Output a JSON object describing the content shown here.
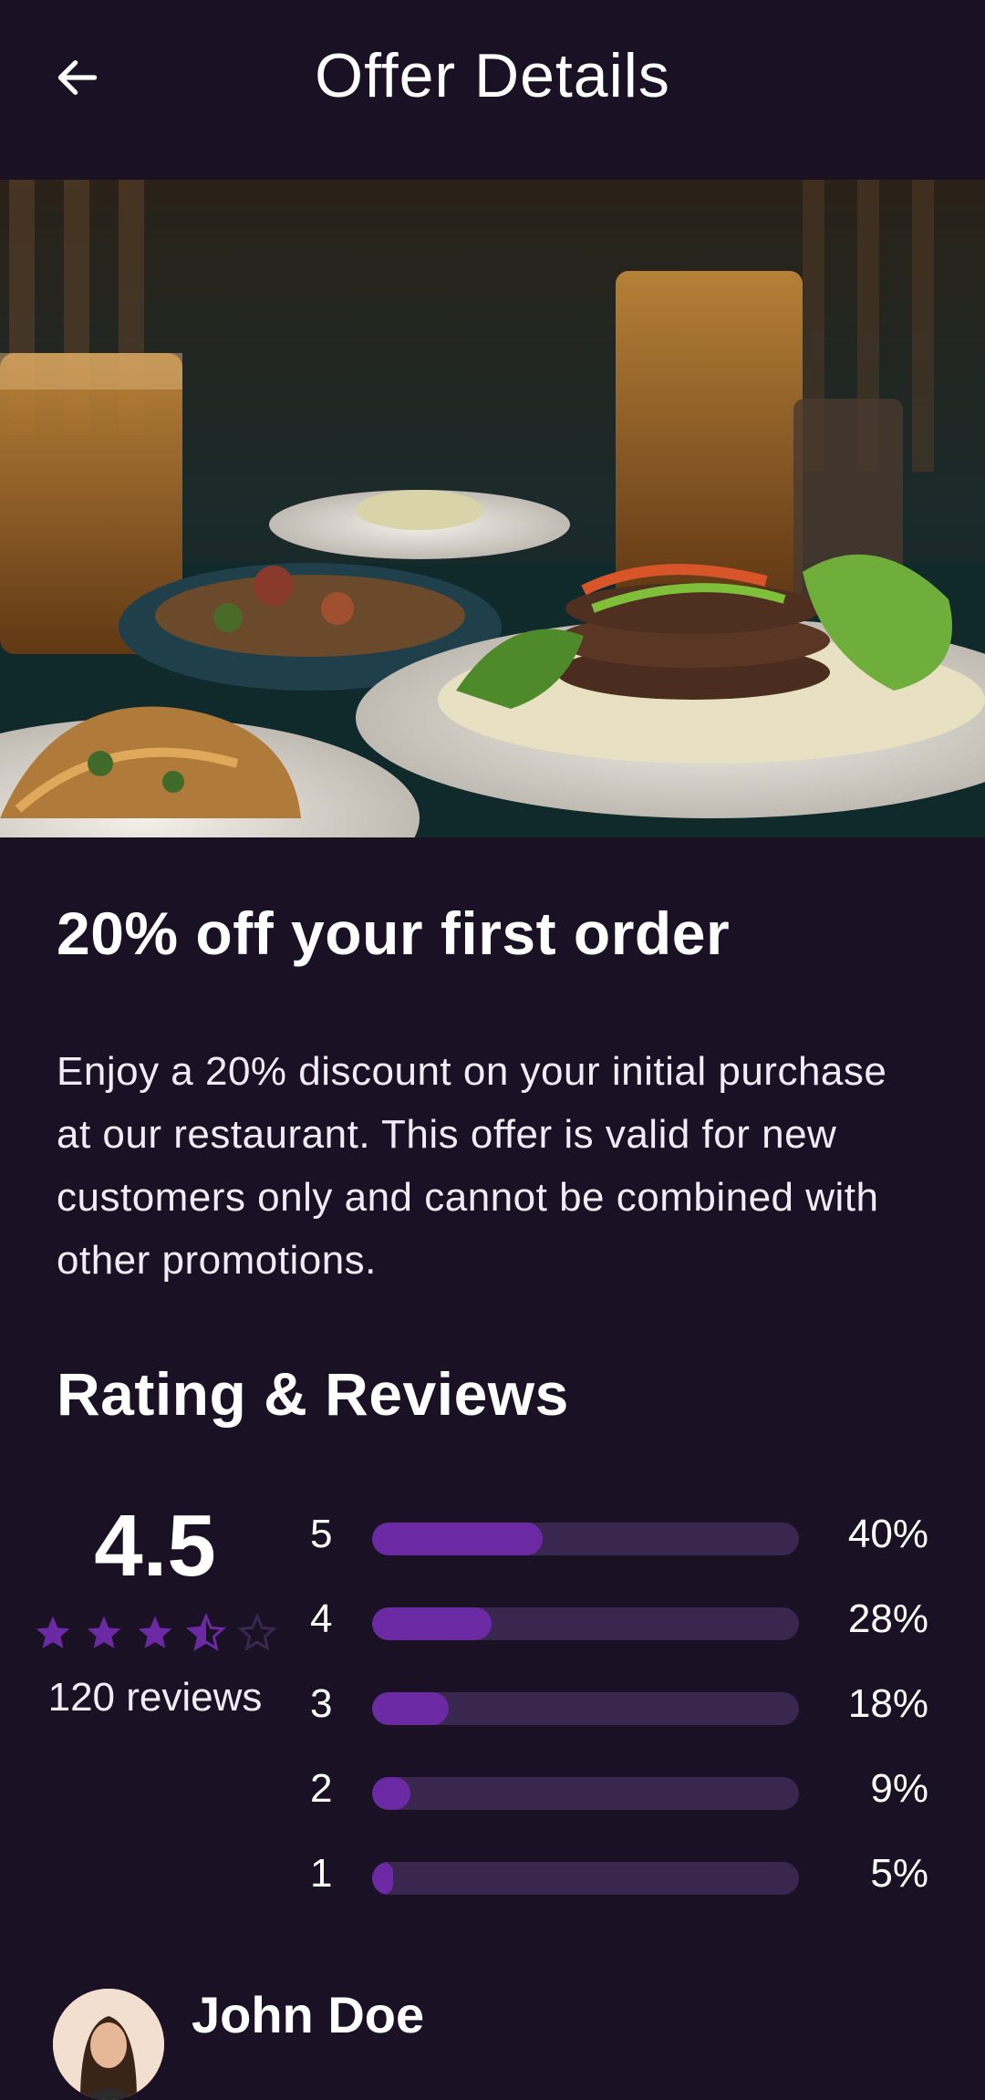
{
  "appbar": {
    "title": "Offer Details",
    "back_icon": "arrow-left-icon"
  },
  "offer": {
    "title": "20% off your first order",
    "description": "Enjoy a 20% discount on your initial purchase at our restaurant. This offer is valid for new customers only and cannot be combined with other promotions."
  },
  "ratings": {
    "section_title": "Rating & Reviews",
    "average": "4.5",
    "stars": 4.5,
    "reviews_count": "120 reviews",
    "distribution": [
      {
        "label": "5",
        "percent": "40%",
        "value": 40
      },
      {
        "label": "4",
        "percent": "28%",
        "value": 28
      },
      {
        "label": "3",
        "percent": "18%",
        "value": 18
      },
      {
        "label": "2",
        "percent": "9%",
        "value": 9
      },
      {
        "label": "1",
        "percent": "5%",
        "value": 5
      }
    ]
  },
  "review": {
    "name": "John Doe"
  },
  "colors": {
    "background": "#1a1124",
    "accent": "#6c29a4",
    "track": "#3a2750"
  }
}
